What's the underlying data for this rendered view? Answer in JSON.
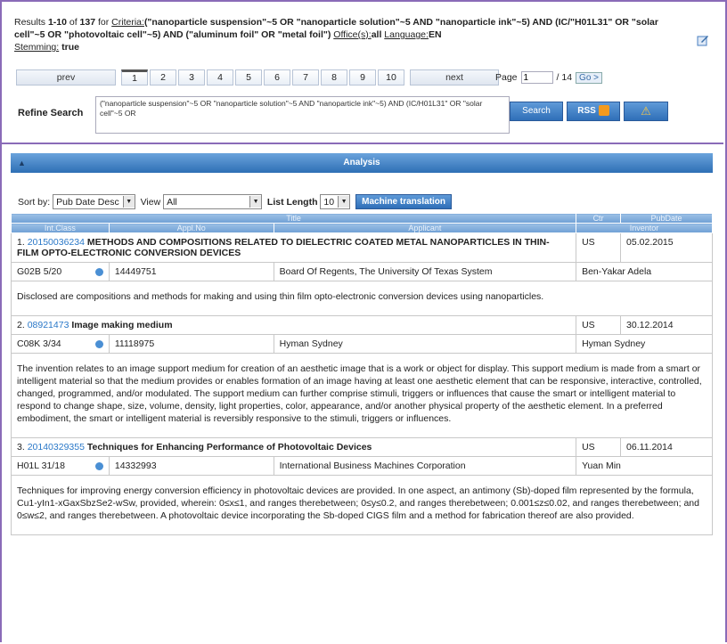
{
  "header": {
    "results_prefix": "Results ",
    "range": "1-10",
    "of_text": " of ",
    "total": "137",
    "for_text": " for ",
    "criteria_label": "Criteria:",
    "criteria_query": "(\"nanoparticle suspension\"~5 OR \"nanoparticle solution\"~5 AND \"nanoparticle ink\"~5) AND (IC/\"H01L31\" OR \"solar cell\"~5 OR \"photovoltaic cell\"~5) AND (\"aluminum foil\" OR \"metal foil\")",
    "office_label": "Office(s):",
    "office_value": "all",
    "language_label": "Language:",
    "language_value": "EN",
    "stemming_label": "Stemming:",
    "stemming_value": "true"
  },
  "pager": {
    "prev": "prev",
    "next": "next",
    "pages": [
      "1",
      "2",
      "3",
      "4",
      "5",
      "6",
      "7",
      "8",
      "9",
      "10"
    ],
    "page_label": "Page",
    "page_value": "1",
    "page_total": "/ 14",
    "go": "Go >"
  },
  "refine": {
    "label": "Refine Search",
    "text": "(\"nanoparticle suspension\"~5 OR \"nanoparticle solution\"~5 AND \"nanoparticle ink\"~5) AND (IC/H01L31\" OR \"solar cell\"~5 OR",
    "search_button": "Search",
    "rss_button": "RSS"
  },
  "analysis": {
    "label": "Analysis"
  },
  "controls": {
    "sort_label": "Sort by:",
    "sort_value": "Pub Date Desc",
    "view_label": "View",
    "view_value": "All",
    "list_length_label": "List Length",
    "list_length_value": "10",
    "machine_translation": "Machine translation"
  },
  "columns": {
    "title": "Title",
    "ctr": "Ctr",
    "pubdate": "PubDate",
    "intclass": "Int.Class",
    "applno": "Appl.No",
    "applicant": "Applicant",
    "inventor": "Inventor"
  },
  "results": [
    {
      "num": "1.",
      "pub": "20150036234",
      "title": "METHODS AND COMPOSITIONS RELATED TO DIELECTRIC COATED METAL NANOPARTICLES IN THIN-FILM OPTO-ELECTRONIC CONVERSION DEVICES",
      "ctr": "US",
      "date": "05.02.2015",
      "intclass": "G02B 5/20",
      "applno": "14449751",
      "applicant": "Board Of Regents, The University Of Texas System",
      "inventor": "Ben-Yakar Adela",
      "abstract": "Disclosed are compositions and methods for making and using thin film opto-electronic conversion devices using nanoparticles."
    },
    {
      "num": "2.",
      "pub": "08921473",
      "title": "Image making medium",
      "ctr": "US",
      "date": "30.12.2014",
      "intclass": "C08K 3/34",
      "applno": "11118975",
      "applicant": "Hyman Sydney",
      "inventor": "Hyman Sydney",
      "abstract": "The invention relates to an image support medium for creation of an aesthetic image that is a work or object for display. This support medium is made from a smart or intelligent material so that the medium provides or enables formation of an image having at least one aesthetic element that can be responsive, interactive, controlled, changed, programmed, and/or modulated. The support medium can further comprise stimuli, triggers or influences that cause the smart or intelligent material to respond to change shape, size, volume, density, light properties, color, appearance, and/or another physical property of the aesthetic element. In a preferred embodiment, the smart or intelligent material is reversibly responsive to the stimuli, triggers or influences."
    },
    {
      "num": "3.",
      "pub": "20140329355",
      "title": "Techniques for Enhancing Performance of Photovoltaic Devices",
      "ctr": "US",
      "date": "06.11.2014",
      "intclass": "H01L 31/18",
      "applno": "14332993",
      "applicant": "International Business Machines Corporation",
      "inventor": "Yuan Min",
      "abstract": "Techniques for improving energy conversion efficiency in photovoltaic devices are provided. In one aspect, an antimony (Sb)-doped film represented by the formula, Cu1-yIn1-xGaxSbzSe2-wSw, provided, wherein: 0≤x≤1, and ranges therebetween; 0≤y≤0.2, and ranges therebetween; 0.001≤z≤0.02, and ranges therebetween; and 0≤w≤2, and ranges therebetween. A photovoltaic device incorporating the Sb-doped CIGS film and a method for fabrication thereof are also provided."
    }
  ]
}
